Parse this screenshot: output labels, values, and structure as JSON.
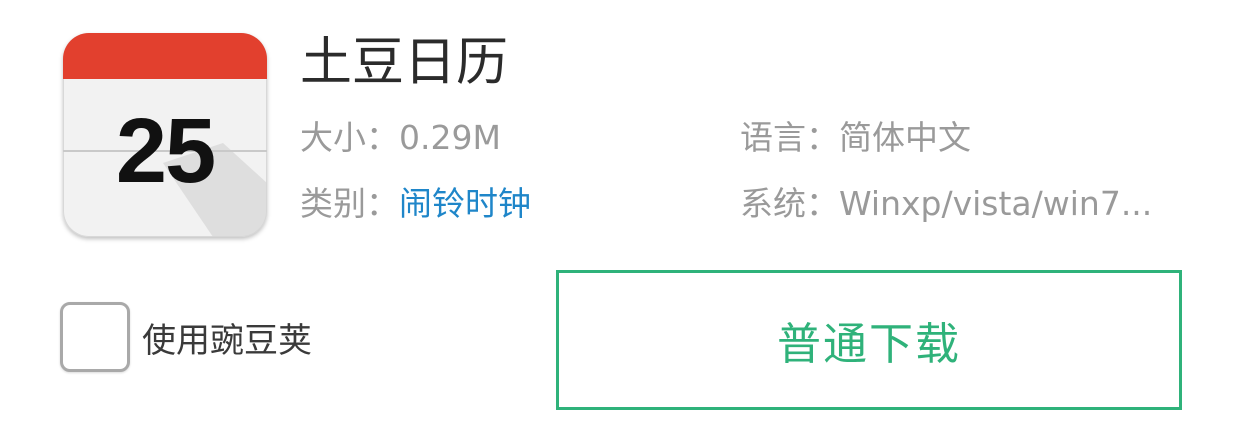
{
  "app": {
    "icon_name": "calendar-icon",
    "icon_day": "25",
    "title": "土豆日历",
    "size_label": "大小：",
    "size_value": "0.29M",
    "category_label": "类别：",
    "category_value": "闹铃时钟",
    "language_label": "语言：",
    "language_value": "简体中文",
    "system_label": "系统：",
    "system_value": "Winxp/vista/win7..."
  },
  "options": {
    "use_wandoujia_label": "使用豌豆荚",
    "use_wandoujia_checked": false
  },
  "actions": {
    "download_label": "普通下载"
  },
  "colors": {
    "accent_green": "#2fb27a",
    "link_blue": "#1f86c9",
    "calendar_red": "#e2402e"
  }
}
